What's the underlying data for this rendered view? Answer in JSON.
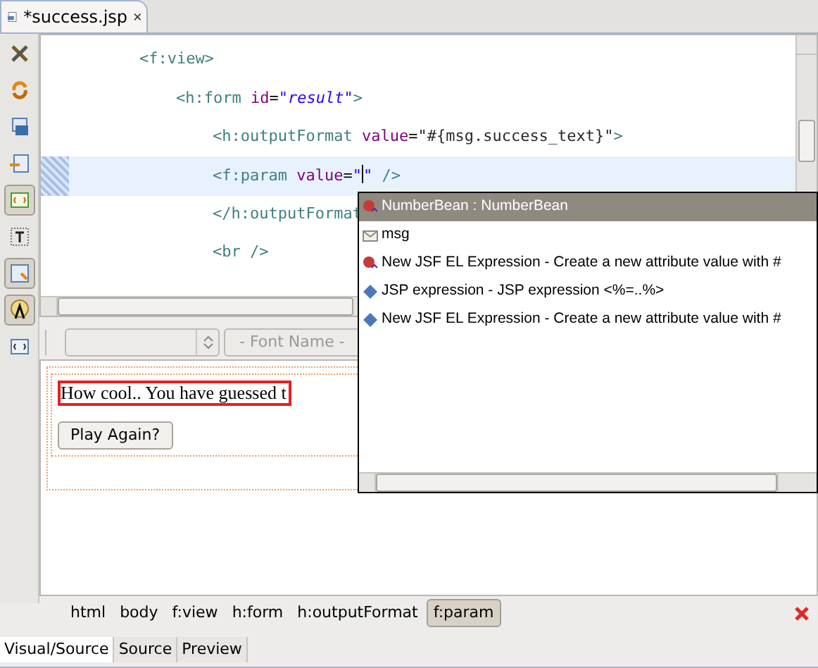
{
  "editor_tab": {
    "title": "*success.jsp",
    "dirty": true
  },
  "left_toolbar": [
    {
      "kind": "tools",
      "pressed": false
    },
    {
      "kind": "refresh",
      "pressed": false
    },
    {
      "kind": "css",
      "pressed": false
    },
    {
      "kind": "import",
      "pressed": false
    },
    {
      "kind": "unknown-tag",
      "pressed": true
    },
    {
      "kind": "text",
      "pressed": false
    },
    {
      "kind": "layout",
      "pressed": true
    },
    {
      "kind": "palette",
      "pressed": true
    },
    {
      "kind": "el",
      "pressed": false
    }
  ],
  "code": [
    {
      "tokens": [
        {
          "kind": "tag",
          "text": "<f:view>"
        }
      ],
      "current": false,
      "children": [
        {
          "tokens": [
            {
              "kind": "tag",
              "text": "<h:form "
            },
            {
              "kind": "attr",
              "text": "id"
            },
            {
              "kind": "plain",
              "text": "="
            },
            {
              "kind": "value",
              "text": "\"result\""
            },
            {
              "kind": "tag",
              "text": ">"
            }
          ],
          "current": false,
          "children": [
            {
              "tokens": [
                {
                  "kind": "tag",
                  "text": "<h:outputFormat "
                },
                {
                  "kind": "attr",
                  "text": "value"
                },
                {
                  "kind": "plain",
                  "text": "="
                },
                {
                  "kind": "el",
                  "text": "\"#{msg.success_text}\""
                },
                {
                  "kind": "tag",
                  "text": ">"
                }
              ],
              "current": false
            },
            {
              "tokens": [
                {
                  "kind": "tag",
                  "text": "<f:param "
                },
                {
                  "kind": "attr",
                  "text": "value"
                },
                {
                  "kind": "plain",
                  "text": "="
                },
                {
                  "kind": "value",
                  "text": "\""
                },
                {
                  "kind": "caret"
                },
                {
                  "kind": "value",
                  "text": "\""
                },
                {
                  "kind": "tag",
                  "text": " />"
                }
              ],
              "current": true
            },
            {
              "tokens": [
                {
                  "kind": "tag",
                  "text": "</h:outputFormat"
                }
              ],
              "current": false
            },
            {
              "tokens": [
                {
                  "kind": "tag",
                  "text": "<br />"
                }
              ],
              "current": false
            }
          ]
        }
      ]
    }
  ],
  "completion": {
    "items": [
      {
        "kind": "bean",
        "label": "NumberBean : NumberBean",
        "selected": true
      },
      {
        "kind": "message",
        "label": "msg",
        "selected": false
      },
      {
        "kind": "el",
        "label": "New JSF EL Expression - Create a new attribute value with #",
        "selected": false
      },
      {
        "kind": "jsp",
        "label": "JSP expression - JSP expression <%=..%>",
        "selected": false
      },
      {
        "kind": "jsp",
        "label": "New JSF EL Expression - Create a new attribute value with #",
        "selected": false
      }
    ]
  },
  "visual_toolbar": {
    "font_name": "- Font Name -"
  },
  "canvas": {
    "text": "How cool.. You have guessed t",
    "button": "Play Again?"
  },
  "breadcrumb": [
    {
      "label": "html",
      "selected": false
    },
    {
      "label": "body",
      "selected": false
    },
    {
      "label": "f:view",
      "selected": false
    },
    {
      "label": "h:form",
      "selected": false
    },
    {
      "label": "h:outputFormat",
      "selected": false
    },
    {
      "label": "f:param",
      "selected": true
    }
  ],
  "bottom_tabs": [
    {
      "label": "Visual/Source",
      "selected": true
    },
    {
      "label": "Source",
      "selected": false
    },
    {
      "label": "Preview",
      "selected": false
    }
  ]
}
